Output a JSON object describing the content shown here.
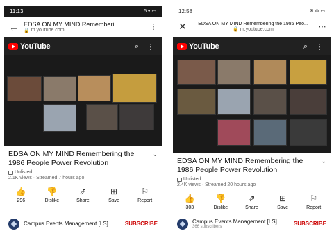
{
  "left": {
    "status": {
      "time": "11:13",
      "icons": "5 ▾ ▭"
    },
    "browser": {
      "page_title": "EDSA ON MY MIND Rememberi...",
      "url": "m.youtube.com"
    },
    "youtube": {
      "brand": "YouTube"
    },
    "video": {
      "title": "EDSA ON MY MIND Remembering the 1986 People Power Revolution",
      "privacy": "Unlisted",
      "meta": "2.1K views · Streamed 7 hours ago"
    },
    "actions": [
      {
        "label": "296"
      },
      {
        "label": "Dislike"
      },
      {
        "label": "Share"
      },
      {
        "label": "Save"
      },
      {
        "label": "Report"
      }
    ],
    "channel": {
      "name": "Campus Events Management [LS]",
      "subs": "",
      "subscribe": "SUBSCRIBE"
    }
  },
  "right": {
    "status": {
      "time": "12:58",
      "icons": "⊠ ⊛ ▭"
    },
    "browser": {
      "page_title": "EDSA ON MY MIND Remembering the 1986 Peo...",
      "url": "m.youtube.com"
    },
    "youtube": {
      "brand": "YouTube"
    },
    "video": {
      "title": "EDSA ON MY MIND Remembering the 1986 People Power Revolution",
      "privacy": "Unlisted",
      "meta": "2.4K views · Streamed 20 hours ago"
    },
    "actions": [
      {
        "label": "303"
      },
      {
        "label": "Dislike"
      },
      {
        "label": "Share"
      },
      {
        "label": "Save"
      },
      {
        "label": "Report"
      }
    ],
    "channel": {
      "name": "Campus Events Management [LS]",
      "subs": "366 subscribers",
      "subscribe": "SUBSCRIBE"
    }
  },
  "icons": {
    "back": "arrow-left-icon",
    "close": "close-icon",
    "lock": "lock-icon",
    "menu": "more-vertical-icon",
    "search": "search-icon",
    "like": "thumbs-up-icon",
    "dislike": "thumbs-down-icon",
    "share": "share-icon",
    "save": "save-to-playlist-icon",
    "report": "flag-icon"
  },
  "colors": {
    "youtube_red": "#ff0000",
    "subscribe_red": "#cc0000",
    "header_dark": "#212121"
  }
}
